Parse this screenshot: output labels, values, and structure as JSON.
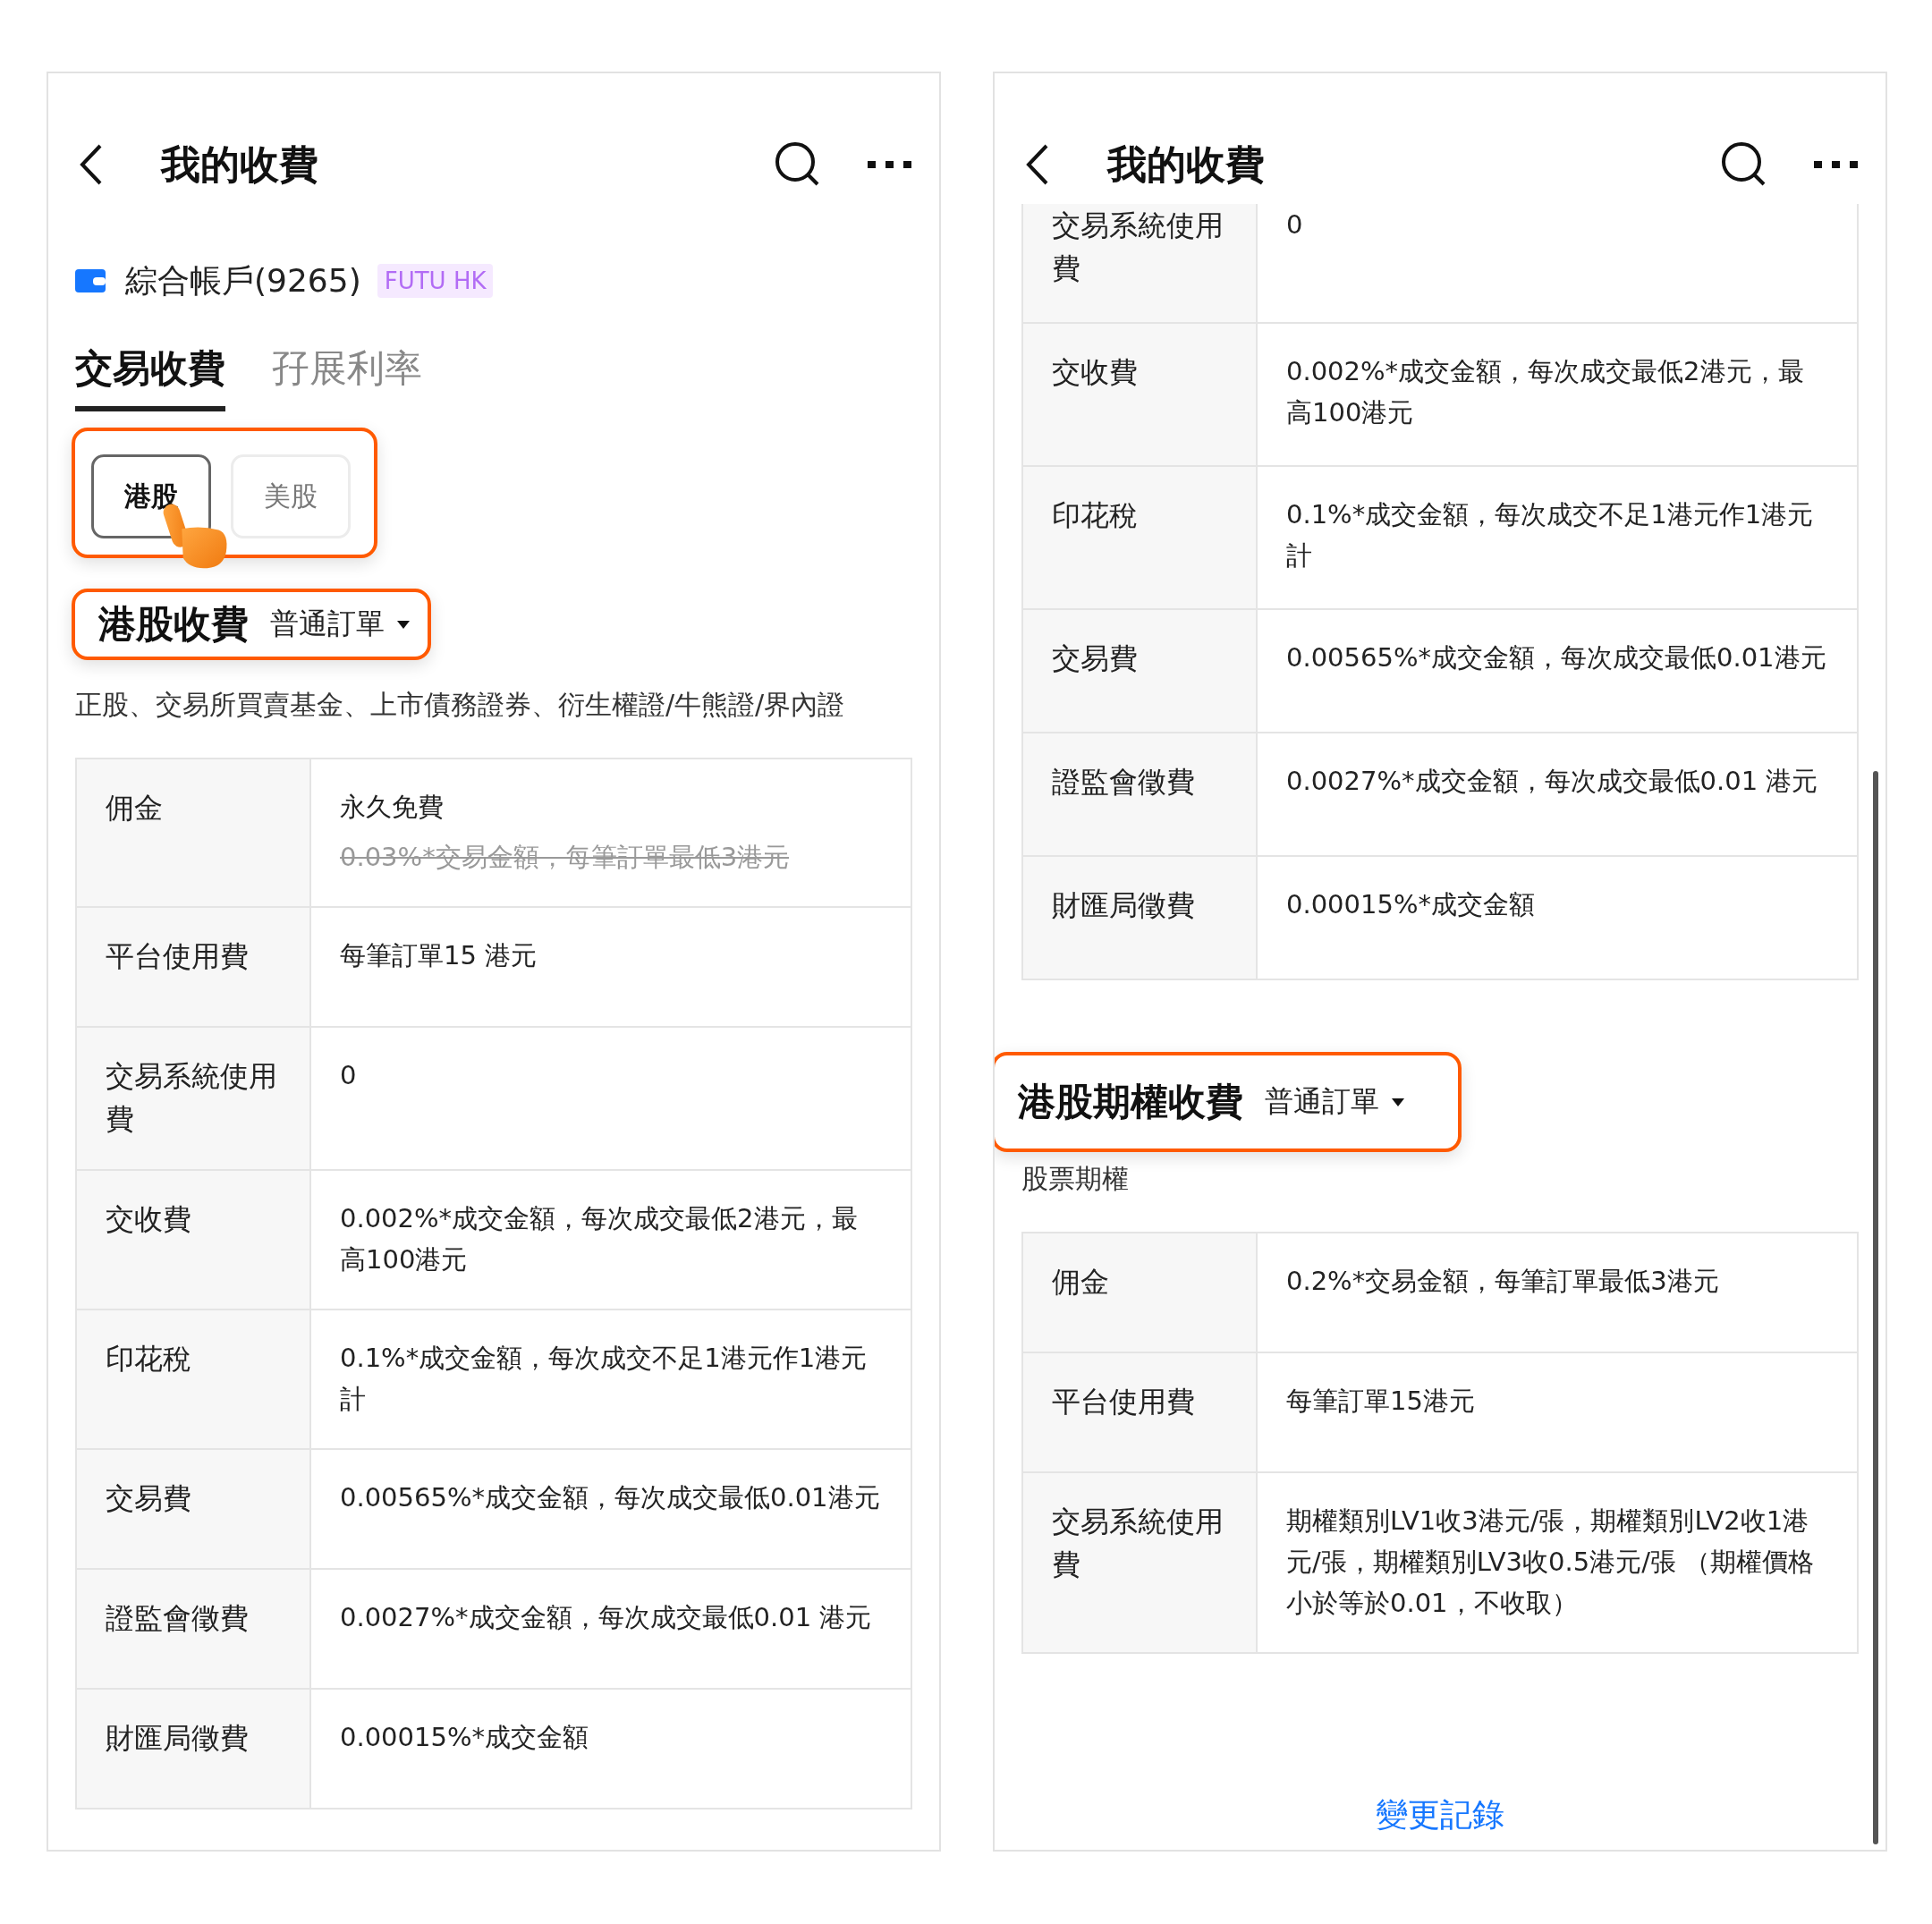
{
  "screens": [
    {
      "header": {
        "title": "我的收費"
      },
      "account": {
        "name": "綜合帳戶(9265)",
        "badge": "FUTU HK"
      },
      "tabs": [
        {
          "label": "交易收費",
          "selected": true
        },
        {
          "label": "孖展利率",
          "selected": false
        }
      ],
      "markets": {
        "highlighted": true,
        "items": [
          {
            "label": "港股",
            "selected": true
          },
          {
            "label": "美股",
            "selected": false
          }
        ]
      },
      "pointer": true,
      "sections": [
        {
          "title": "港股收費",
          "order_type": "普通訂單",
          "highlighted": true,
          "description": "正股、交易所買賣基金、上市債務證券、衍生權證/牛熊證/界內證",
          "rows": [
            {
              "label": "佣金",
              "value": "永久免費",
              "former_value": "0.03%*交易金額，每筆訂單最低3港元"
            },
            {
              "label": "平台使用費",
              "value": "每筆訂單15 港元"
            },
            {
              "label": "交易系統使用費",
              "value": "0"
            },
            {
              "label": "交收費",
              "value": "0.002%*成交金額，每次成交最低2港元，最高100港元"
            },
            {
              "label": "印花稅",
              "value": "0.1%*成交金額，每次成交不足1港元作1港元計"
            },
            {
              "label": "交易費",
              "value": "0.00565%*成交金額，每次成交最低0.01港元"
            },
            {
              "label": "證監會徵費",
              "value": "0.0027%*成交金額，每次成交最低0.01 港元"
            },
            {
              "label": "財匯局徵費",
              "value": "0.00015%*成交金額"
            }
          ]
        }
      ]
    },
    {
      "header": {
        "title": "我的收費"
      },
      "scrolled": true,
      "sections": [
        {
          "rows": [
            {
              "label": "交易系統使用費",
              "value": "0"
            },
            {
              "label": "交收費",
              "value": "0.002%*成交金額，每次成交最低2港元，最高100港元"
            },
            {
              "label": "印花稅",
              "value": "0.1%*成交金額，每次成交不足1港元作1港元計"
            },
            {
              "label": "交易費",
              "value": "0.00565%*成交金額，每次成交最低0.01港元"
            },
            {
              "label": "證監會徵費",
              "value": "0.0027%*成交金額，每次成交最低0.01 港元"
            },
            {
              "label": "財匯局徵費",
              "value": "0.00015%*成交金額"
            }
          ]
        },
        {
          "title": "港股期權收費",
          "order_type": "普通訂單",
          "highlighted": true,
          "description": "股票期權",
          "rows": [
            {
              "label": "佣金",
              "value": "0.2%*交易金額，每筆訂單最低3港元"
            },
            {
              "label": "平台使用費",
              "value": "每筆訂單15港元"
            },
            {
              "label": "交易系統使用費",
              "value": "期權類別LV1收3港元/張，期權類別LV2收1港元/張，期權類別LV3收0.5港元/張 （期權價格小於等於0.01，不收取）"
            }
          ]
        }
      ],
      "link": "變更記錄"
    }
  ]
}
